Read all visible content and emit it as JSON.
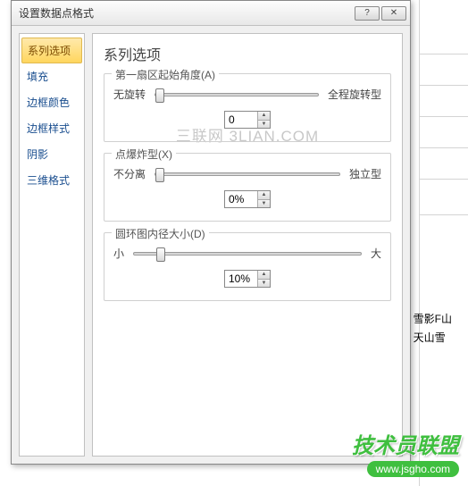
{
  "dialog": {
    "title": "设置数据点格式",
    "help_symbol": "?",
    "close_symbol": "✕"
  },
  "sidebar": {
    "items": [
      {
        "label": "系列选项",
        "selected": true
      },
      {
        "label": "填充"
      },
      {
        "label": "边框颜色"
      },
      {
        "label": "边框样式"
      },
      {
        "label": "阴影"
      },
      {
        "label": "三维格式"
      }
    ]
  },
  "panel": {
    "title": "系列选项",
    "watermark": "三联网 3LIAN.COM",
    "group1": {
      "label": "第一扇区起始角度(A)",
      "left": "无旋转",
      "right": "全程旋转型",
      "value": "0",
      "thumb_pct": 0
    },
    "group2": {
      "label": "点爆炸型(X)",
      "left": "不分离",
      "right": "独立型",
      "value": "0%",
      "thumb_pct": 0
    },
    "group3": {
      "label": "圆环图内径大小(D)",
      "left": "小",
      "right": "大",
      "value": "10%",
      "thumb_pct": 10
    }
  },
  "legend": {
    "items": [
      {
        "label": "雪影F山",
        "color": "#4a6fb3"
      },
      {
        "label": "天山雪",
        "color": "#c05a4a"
      }
    ]
  },
  "brand": {
    "text": "技术员联盟",
    "url": "www.jsgho.com"
  }
}
